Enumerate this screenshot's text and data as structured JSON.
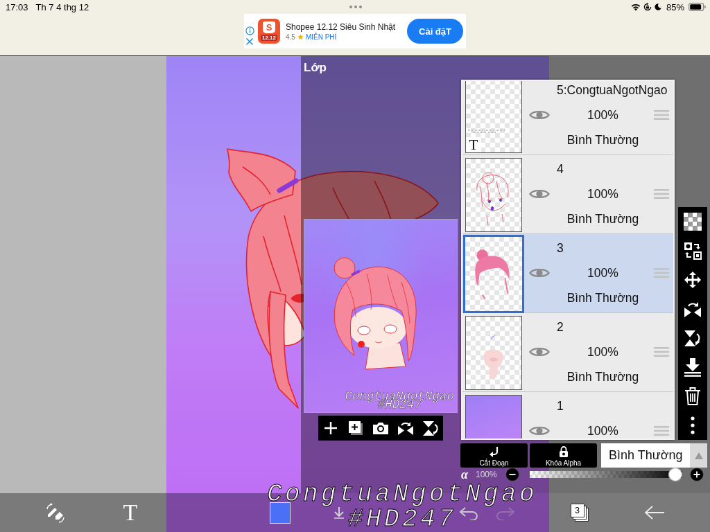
{
  "status_bar": {
    "time": "17:03",
    "date": "Th 7 4 thg 12",
    "battery": "85%"
  },
  "ad": {
    "logo_letter": "S",
    "logo_label": "12.12",
    "title": "Shopee 12.12 Siêu Sinh Nhật",
    "rating": "4.5",
    "price": "MIỄN PHÍ",
    "button": "Cài đặT"
  },
  "canvas": {
    "text_lines": [
      "CongtuaNgotNgao",
      "#HD247"
    ]
  },
  "layers_panel": {
    "title": "Lớp",
    "preview": {
      "text_lines": [
        "CongtuaNgotNgao",
        "#HD247"
      ]
    },
    "layers": [
      {
        "name": "5:CongtuaNgotNgao",
        "thumbnail": {
          "kind": "text",
          "label": "T"
        },
        "opacity": "100%",
        "blend": "Bình Thường",
        "selected": false
      },
      {
        "name": "4",
        "thumbnail": {
          "kind": "lineart"
        },
        "opacity": "100%",
        "blend": "Bình Thường",
        "selected": false
      },
      {
        "name": "3",
        "thumbnail": {
          "kind": "hair"
        },
        "opacity": "100%",
        "blend": "Bình Thường",
        "selected": true
      },
      {
        "name": "2",
        "thumbnail": {
          "kind": "skin"
        },
        "opacity": "100%",
        "blend": "Bình Thường",
        "selected": false
      },
      {
        "name": "1",
        "thumbnail": {
          "kind": "background"
        },
        "opacity": "100%",
        "selected": false
      }
    ],
    "clip_button": "Cắt Đoạn",
    "alpha_lock_button": "Khóa Alpha",
    "blend_mode": "Bình Thường",
    "alpha_symbol": "α",
    "opacity_reading": "100%",
    "opacity_slider": {
      "level": 1
    }
  },
  "toolbar": {
    "text_tool": "T",
    "color_swatch": {
      "color": "#4b70f5"
    },
    "layer_count": "3",
    "redo": {
      "disabled": true
    }
  }
}
